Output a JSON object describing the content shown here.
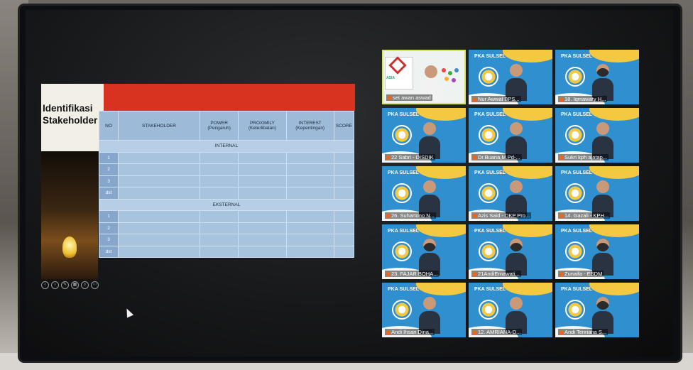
{
  "slide": {
    "title": "Identifikasi Stakeholder",
    "table": {
      "headers": [
        "NO",
        "STAKEHOLDER",
        "POWER (Pengaruh)",
        "PROXIMILY (Keterlibatan)",
        "INTEREST (Kepentingan)",
        "SCORE"
      ],
      "sections": [
        {
          "label": "INTERNAL",
          "rows": [
            "1",
            "2",
            "3",
            "dst"
          ]
        },
        {
          "label": "EKSTERNAL",
          "rows": [
            "1",
            "2",
            "3",
            "dst"
          ]
        }
      ]
    }
  },
  "participants": [
    {
      "name": "set awan aswad",
      "active": true
    },
    {
      "name": "Nur Awwal BPS..."
    },
    {
      "name": "18. Iqmawaty H..."
    },
    {
      "name": "22 Sabri - DISDIK"
    },
    {
      "name": "Dr.Buana,M.Pd-..."
    },
    {
      "name": "Sukri kph ajatap..."
    },
    {
      "name": "26. Suhartono N..."
    },
    {
      "name": "Azis Said - DKP Pro..."
    },
    {
      "name": "14. Gazali - KPH..."
    },
    {
      "name": "23. FAJAR BOHA..."
    },
    {
      "name": "21AndiErnawati..."
    },
    {
      "name": "Zunaifa - ESDM"
    },
    {
      "name": "Andi Ihsan Dina..."
    },
    {
      "name": "12. AMRIANA-D..."
    },
    {
      "name": "Andi Tenriana S..."
    }
  ],
  "tile_brand": "PKA SULSEL",
  "colors": {
    "accent_red": "#d83320",
    "table_blue": "#a8c3de",
    "tile_blue": "#2f8fcf",
    "tile_yellow": "#f5c842"
  }
}
